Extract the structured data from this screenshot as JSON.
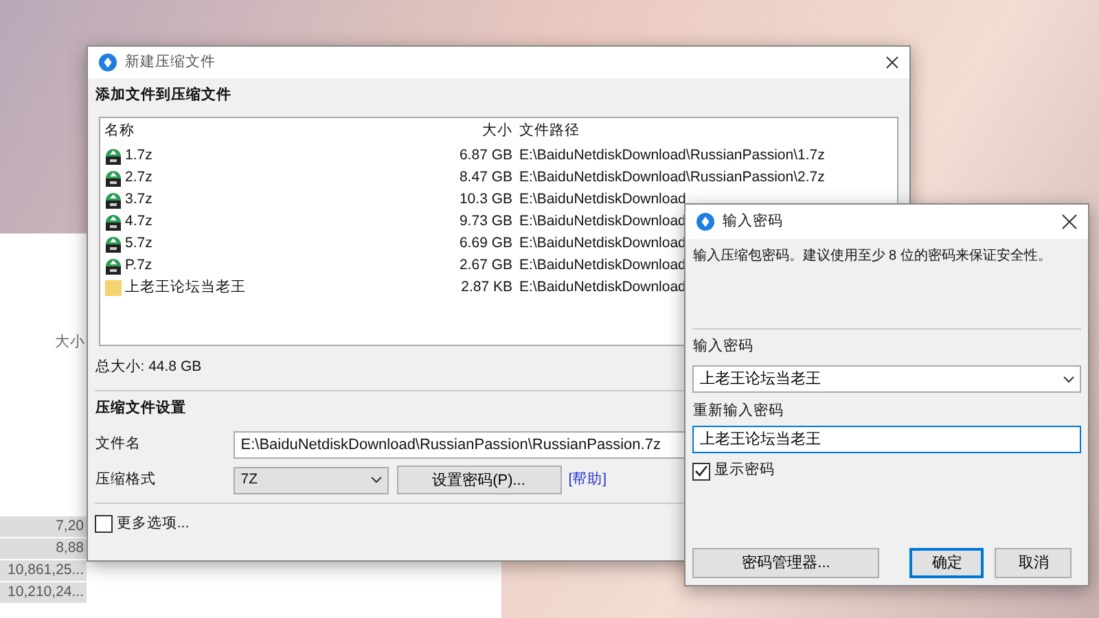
{
  "background_window": {
    "column_header": "大小",
    "cells": [
      "7,20",
      "8,88",
      "10,861,25...",
      "10,210,24..."
    ]
  },
  "main_dialog": {
    "title": "新建压缩文件",
    "section_title": "添加文件到压缩文件",
    "columns": [
      "名称",
      "大小",
      "文件路径"
    ],
    "files": [
      {
        "kind": "archive",
        "name": "1.7z",
        "size": "6.87 GB",
        "path": "E:\\BaiduNetdiskDownload\\RussianPassion\\1.7z"
      },
      {
        "kind": "archive",
        "name": "2.7z",
        "size": "8.47 GB",
        "path": "E:\\BaiduNetdiskDownload\\RussianPassion\\2.7z"
      },
      {
        "kind": "archive",
        "name": "3.7z",
        "size": "10.3 GB",
        "path": "E:\\BaiduNetdiskDownload"
      },
      {
        "kind": "archive",
        "name": "4.7z",
        "size": "9.73 GB",
        "path": "E:\\BaiduNetdiskDownload"
      },
      {
        "kind": "archive",
        "name": "5.7z",
        "size": "6.69 GB",
        "path": "E:\\BaiduNetdiskDownload"
      },
      {
        "kind": "archive",
        "name": "P.7z",
        "size": "2.67 GB",
        "path": "E:\\BaiduNetdiskDownload"
      },
      {
        "kind": "folder",
        "name": "上老王论坛当老王",
        "size": "2.87 KB",
        "path": "E:\\BaiduNetdiskDownload"
      }
    ],
    "total": "总大小: 44.8 GB",
    "settings_title": "压缩文件设置",
    "filename_label": "文件名",
    "filename_value": "E:\\BaiduNetdiskDownload\\RussianPassion\\RussianPassion.7z",
    "format_label": "压缩格式",
    "format_value": "7Z",
    "password_button": "设置密码(P)...",
    "help_link": "[帮助]",
    "more_options": {
      "label": "更多选项...",
      "checked": false
    }
  },
  "password_dialog": {
    "title": "输入密码",
    "hint": "输入压缩包密码。建议使用至少 8 位的密码来保证安全性。",
    "password_label": "输入密码",
    "password_value": "上老王论坛当老王",
    "confirm_label": "重新输入密码",
    "confirm_value": "上老王论坛当老王",
    "show_password": {
      "label": "显示密码",
      "checked": true
    },
    "buttons": [
      {
        "label": "密码管理器...",
        "default": false
      },
      {
        "label": "确定",
        "default": true
      },
      {
        "label": "取消",
        "default": false
      }
    ]
  }
}
